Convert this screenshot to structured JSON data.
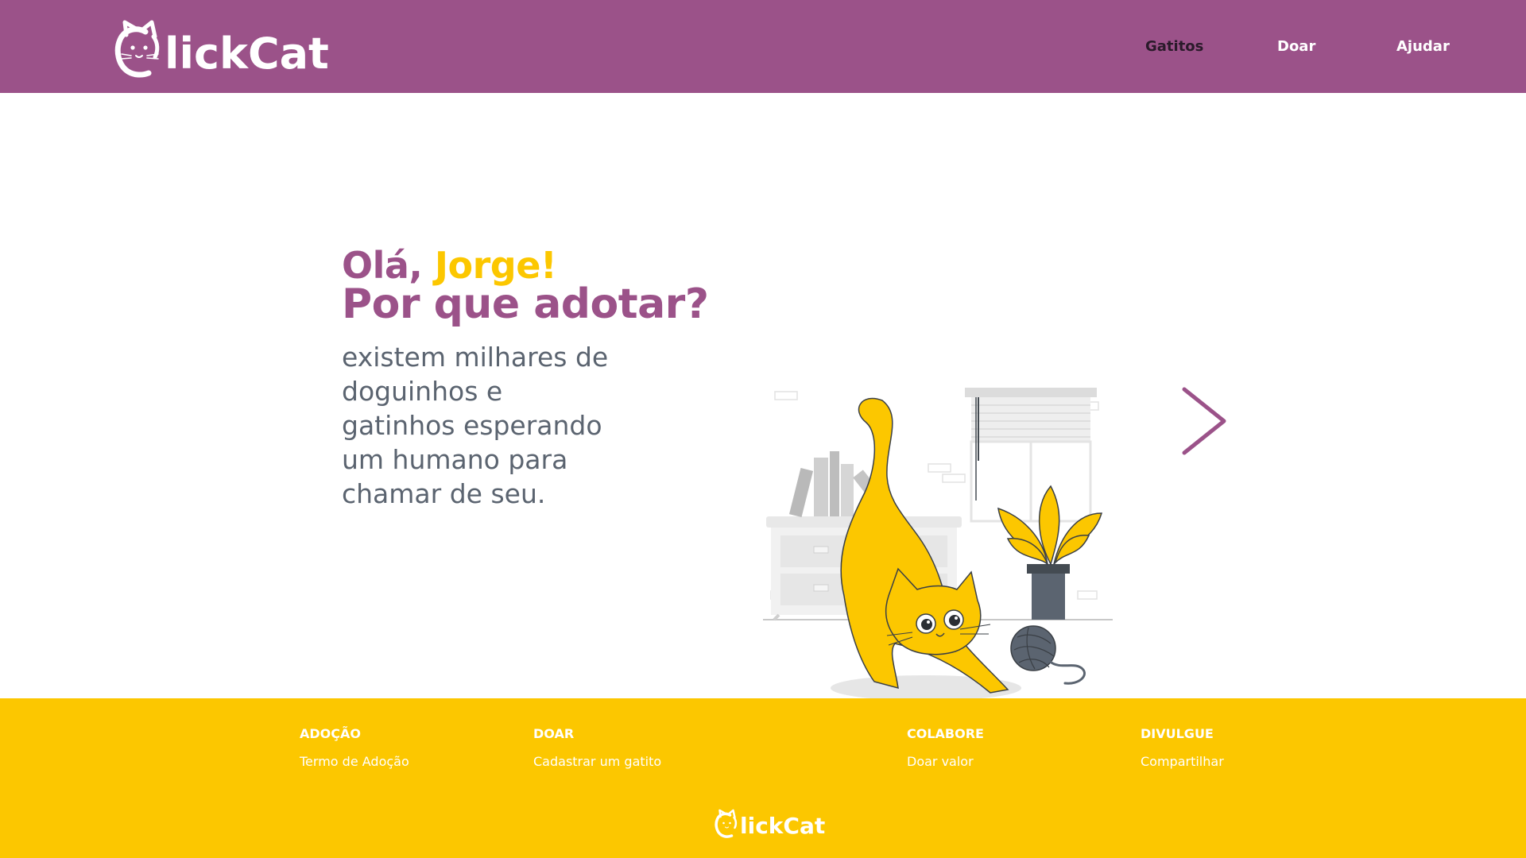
{
  "header": {
    "logo_text": "lickCat",
    "nav": [
      {
        "label": "Gatitos",
        "active": true
      },
      {
        "label": "Doar",
        "active": false
      },
      {
        "label": "Ajudar",
        "active": false
      }
    ]
  },
  "hero": {
    "greeting": "Olá, ",
    "user_name": "Jorge!",
    "title": "Por que adotar?",
    "body": "existem milhares de doguinhos e gatinhos esperando um humano para chamar de seu."
  },
  "footer": {
    "columns": [
      {
        "heading": "ADOÇÃO",
        "link": "Termo de Adoção"
      },
      {
        "heading": "DOAR",
        "link": "Cadastrar um gatito"
      },
      {
        "heading": "COLABORE",
        "link": "Doar valor"
      },
      {
        "heading": "DIVULGUE",
        "link": "Compartilhar"
      }
    ],
    "logo_text": "lickCat"
  },
  "colors": {
    "brand_purple": "#9b5289",
    "brand_yellow": "#fcc700",
    "body_text": "#5b6470"
  },
  "icons": {
    "logo": "cat-head-icon",
    "carousel_next": "chevron-right-icon"
  }
}
